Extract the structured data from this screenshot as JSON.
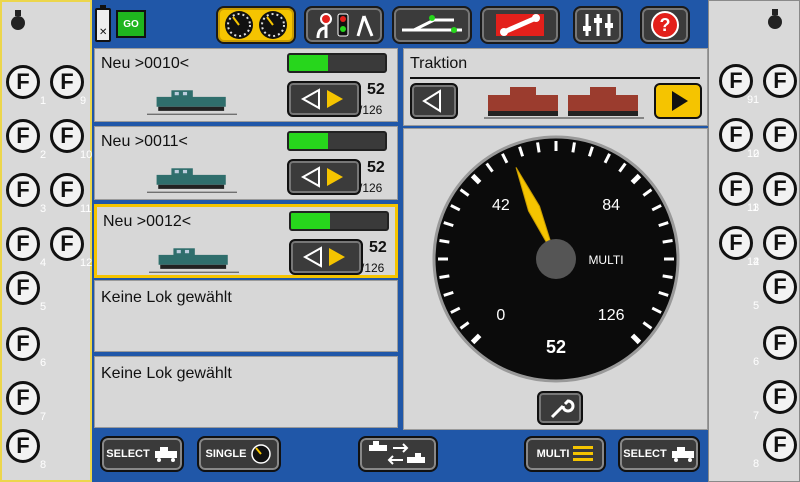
{
  "left_functions": [
    {
      "label": "F",
      "num": "1"
    },
    {
      "label": "F",
      "num": "9"
    },
    {
      "label": "F",
      "num": "2"
    },
    {
      "label": "F",
      "num": "10"
    },
    {
      "label": "F",
      "num": "3"
    },
    {
      "label": "F",
      "num": "11"
    },
    {
      "label": "F",
      "num": "4"
    },
    {
      "label": "F",
      "num": "12"
    },
    {
      "label": "F",
      "num": "5"
    },
    {
      "label": "F",
      "num": "6"
    },
    {
      "label": "F",
      "num": "7"
    },
    {
      "label": "F",
      "num": "8"
    }
  ],
  "right_functions": [
    {
      "label": "F",
      "num": "9"
    },
    {
      "label": "F",
      "num": "1"
    },
    {
      "label": "F",
      "num": "10"
    },
    {
      "label": "F",
      "num": "2"
    },
    {
      "label": "F",
      "num": "11"
    },
    {
      "label": "F",
      "num": "3"
    },
    {
      "label": "F",
      "num": "12"
    },
    {
      "label": "F",
      "num": "4"
    },
    {
      "label": "F",
      "num": "5"
    },
    {
      "label": "F",
      "num": "6"
    },
    {
      "label": "F",
      "num": "7"
    },
    {
      "label": "F",
      "num": "8"
    }
  ],
  "status": {
    "go_label": "GO"
  },
  "locos": [
    {
      "name": "Neu >0010<",
      "speed": "52",
      "max": "/126",
      "progress": 0.41
    },
    {
      "name": "Neu >0011<",
      "speed": "52",
      "max": "/126",
      "progress": 0.41
    },
    {
      "name": "Neu >0012<",
      "speed": "52",
      "max": "/126",
      "progress": 0.41
    }
  ],
  "empty_slots": [
    {
      "label": "Keine Lok gewählt"
    },
    {
      "label": "Keine Lok gewählt"
    }
  ],
  "traction": {
    "title": "Traktion"
  },
  "gauge": {
    "ticks": [
      "0",
      "42",
      "84",
      "126"
    ],
    "mode_label": "MULTI",
    "speed": "52",
    "max": 126
  },
  "bottom": {
    "select_left": "SELECT",
    "single": "SINGLE",
    "multi": "MULTI",
    "select_right": "SELECT"
  },
  "colors": {
    "accent": "#f5c400",
    "go_green": "#1fb51f",
    "help_red": "#e3201b",
    "bar_green": "#27d61c"
  }
}
